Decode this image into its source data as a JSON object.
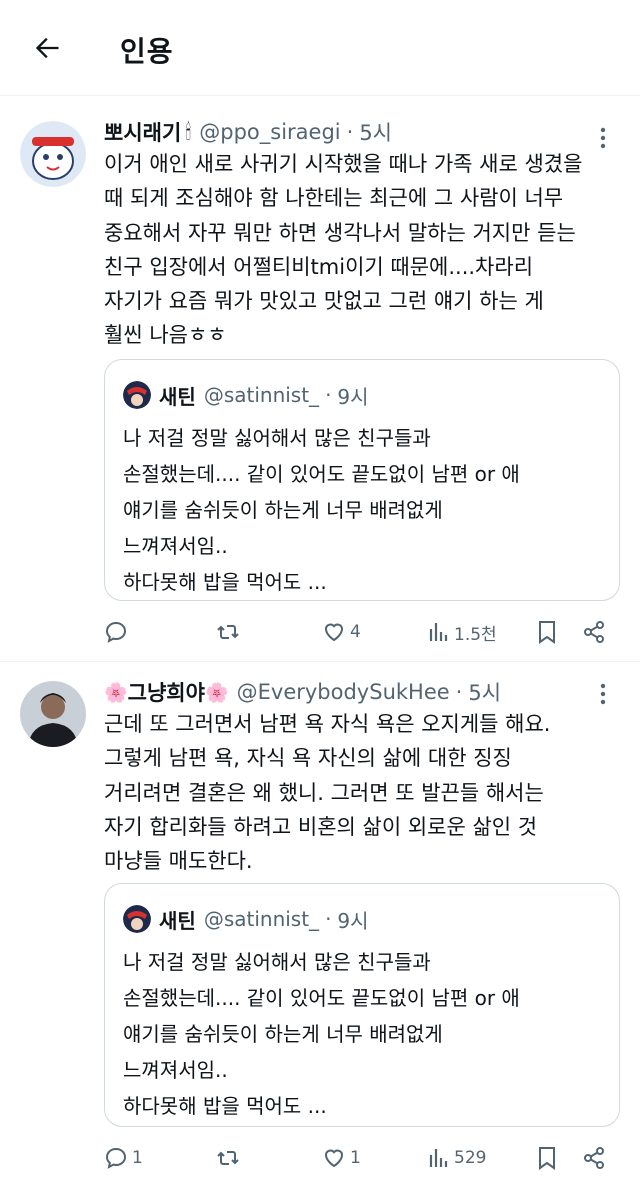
{
  "header": {
    "title": "인용",
    "back_icon": "arrow-left-icon"
  },
  "tweets": [
    {
      "display_name": "뽀시래기",
      "name_emoji": "🕯",
      "handle": "@ppo_siraegi",
      "separator": "·",
      "time": "5시",
      "body": "이거 애인 새로 사귀기 시작했을 때나 가족 새로 생겼을\n때 되게 조심해야 함 나한테는 최근에 그 사람이 너무\n중요해서 자꾸 뭐만 하면 생각나서 말하는 거지만 듣는\n친구 입장에서 어쩔티비tmi이기 때문에....차라리\n자기가 요즘 뭐가 맛있고 맛없고 그런 얘기 하는 게\n훨씬 나음ㅎㅎ",
      "quote": {
        "display_name": "새틴",
        "handle": "@satinnist_",
        "separator": "·",
        "time": "9시",
        "body": "나 저걸 정말 싫어해서 많은 친구들과\n손절했는데.... 같이 있어도 끝도없이 남편 or 애\n얘기를 숨쉬듯이 하는게 너무 배려없게\n느껴져서임..\n하다못해 밥을 먹어도 ..."
      },
      "stats": {
        "replies": "",
        "retweets": "",
        "likes": "4",
        "views": "1.5천"
      }
    },
    {
      "display_name": "그냥희야",
      "name_prefix": "🌸",
      "name_suffix": "🌸",
      "handle": "@EverybodySukHee",
      "separator": "·",
      "time": "5시",
      "body": "근데 또 그러면서 남편 욕 자식 욕은 오지게들 해요.\n그렇게 남편 욕, 자식 욕 자신의 삶에 대한 징징\n거리려면 결혼은 왜 했니. 그러면 또 발끈들 해서는\n자기 합리화들 하려고 비혼의 삶이 외로운 삶인 것\n마냥들 매도한다.",
      "quote": {
        "display_name": "새틴",
        "handle": "@satinnist_",
        "separator": "·",
        "time": "9시",
        "body": "나 저걸 정말 싫어해서 많은 친구들과\n손절했는데.... 같이 있어도 끝도없이 남편 or 애\n얘기를 숨쉬듯이 하는게 너무 배려없게\n느껴져서임..\n하다못해 밥을 먹어도 ..."
      },
      "stats": {
        "replies": "1",
        "retweets": "",
        "likes": "1",
        "views": "529"
      }
    }
  ],
  "colors": {
    "text": "#0f1419",
    "secondary": "#536471",
    "border": "#cfd9de",
    "divider": "#eff3f4"
  }
}
